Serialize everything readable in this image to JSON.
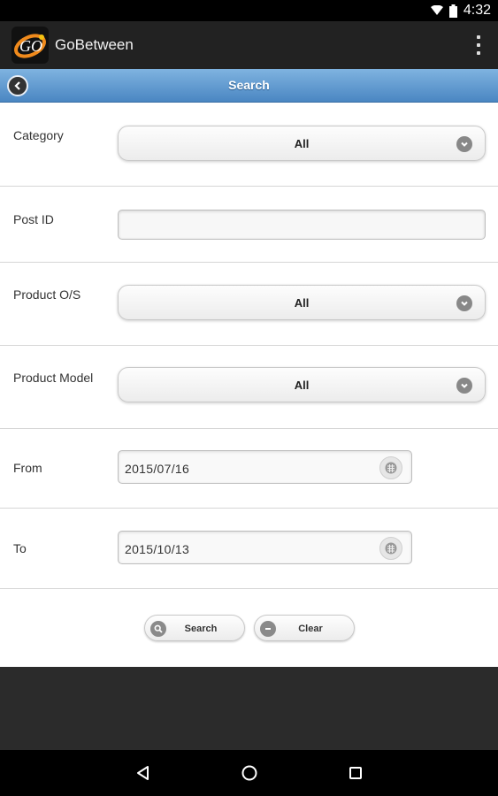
{
  "status_bar": {
    "time": "4:32",
    "icons": [
      "wifi-icon",
      "battery-icon"
    ]
  },
  "app_bar": {
    "title": "GoBetween",
    "logo_text": "GO"
  },
  "header": {
    "title": "Search"
  },
  "form": {
    "category": {
      "label": "Category",
      "value": "All"
    },
    "post_id": {
      "label": "Post ID",
      "value": ""
    },
    "product_os": {
      "label": "Product O/S",
      "value": "All"
    },
    "product_model": {
      "label": "Product Model",
      "value": "All"
    },
    "from": {
      "label": "From",
      "value": "2015/07/16"
    },
    "to": {
      "label": "To",
      "value": "2015/10/13"
    }
  },
  "buttons": {
    "search": "Search",
    "clear": "Clear"
  },
  "colors": {
    "header_top": "#7fb3e0",
    "header_bottom": "#4a86c2",
    "app_bar": "#222222",
    "background": "#2b2b2b"
  }
}
